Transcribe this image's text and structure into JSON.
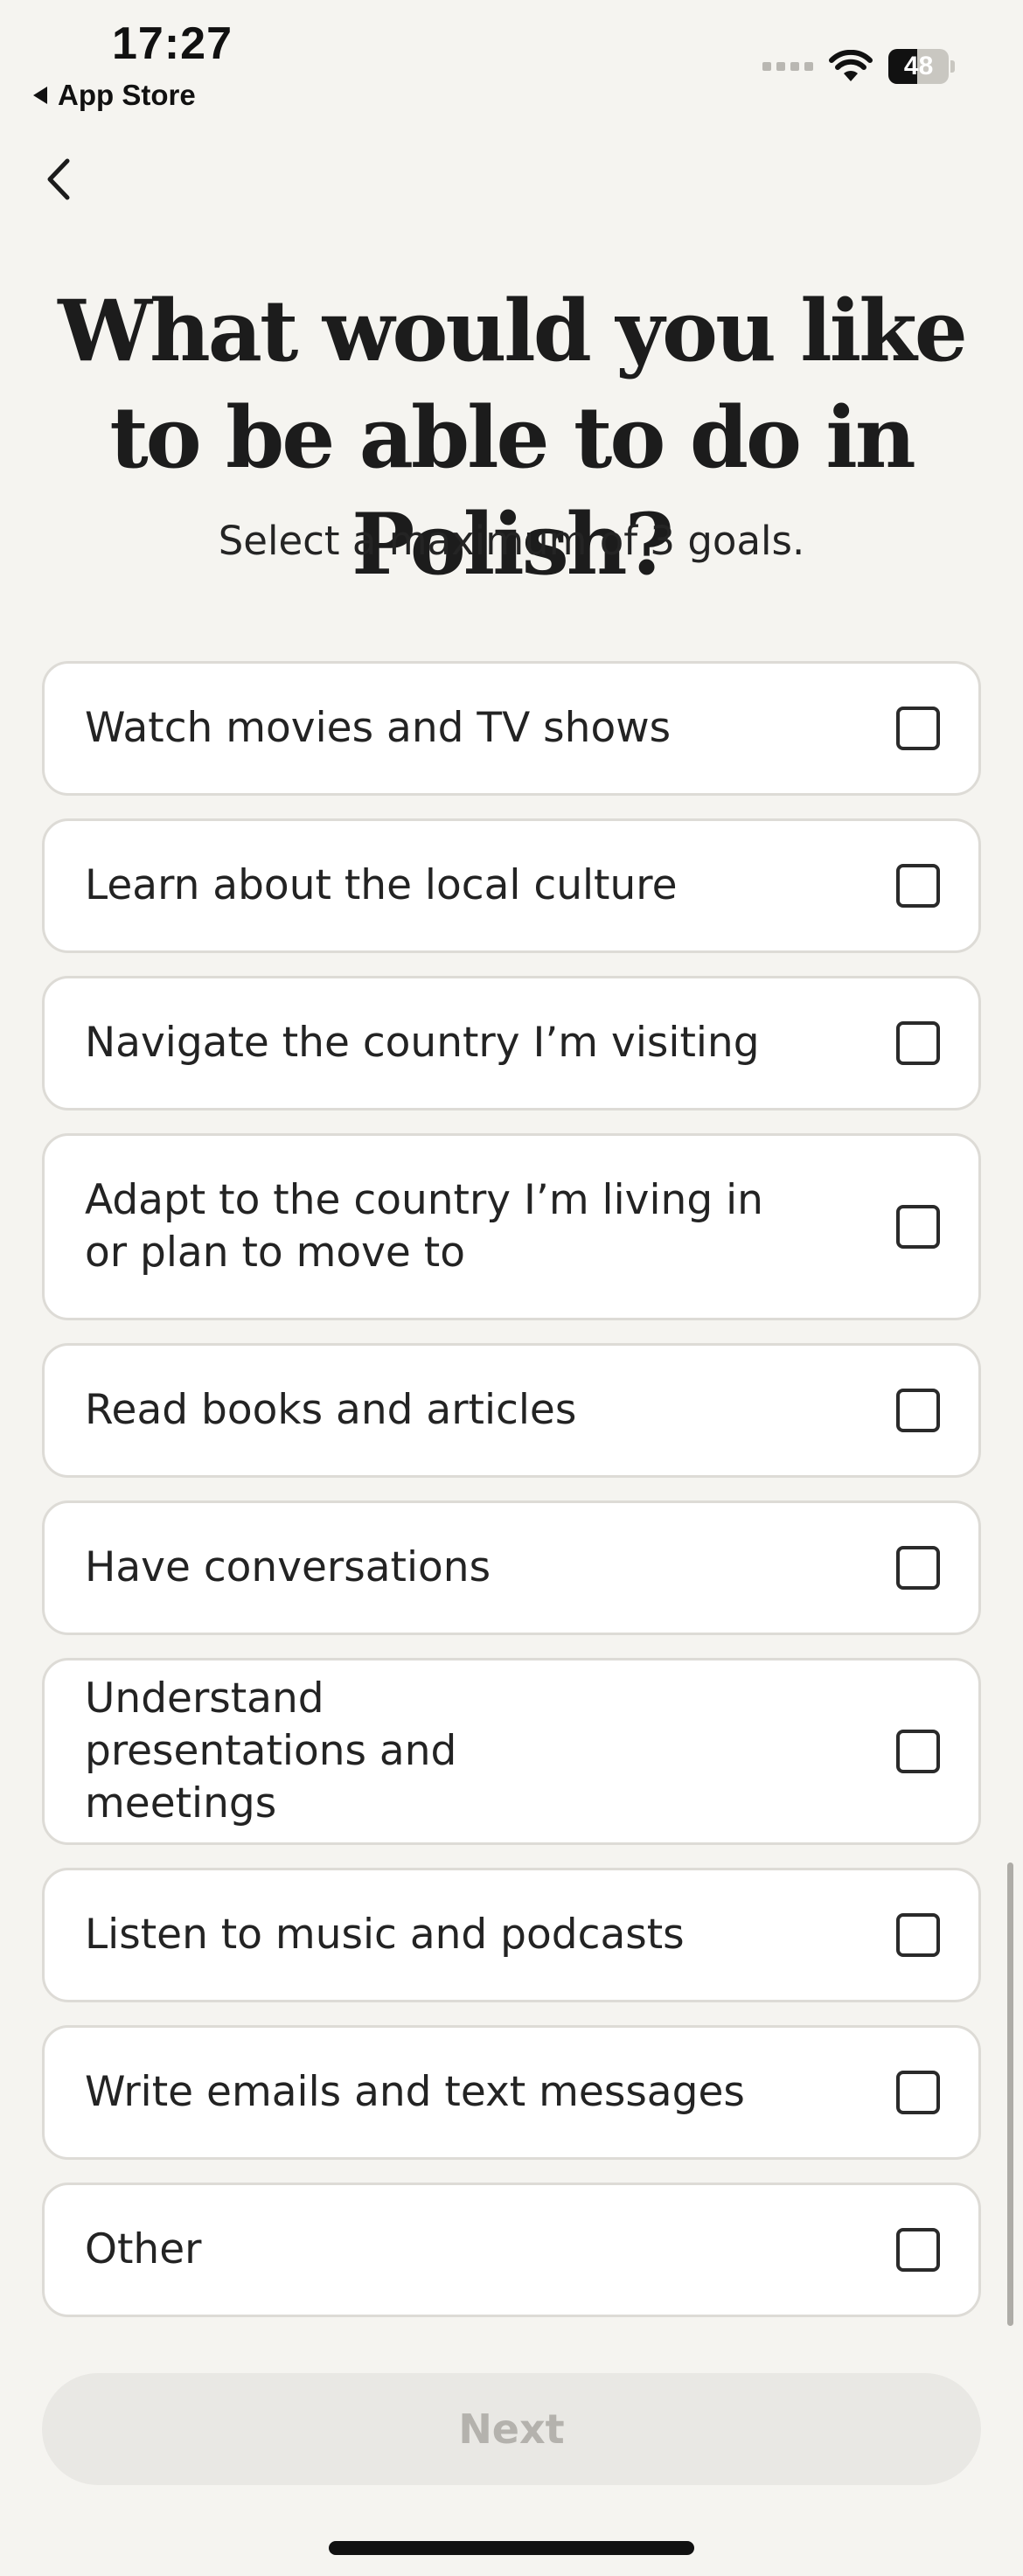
{
  "status_bar": {
    "time": "17:27",
    "back_app": "App Store",
    "battery": "48",
    "battery_level": 0.48
  },
  "header": {
    "title": "What would you like to be able to do in Polish?",
    "subtitle": "Select a maximum of 3 goals."
  },
  "goals": [
    {
      "label": "Watch movies and TV shows",
      "checked": false
    },
    {
      "label": "Learn about the local culture",
      "checked": false
    },
    {
      "label": "Navigate the country I’m visiting",
      "checked": false
    },
    {
      "label": "Adapt to the country I’m living in or plan to move to",
      "checked": false
    },
    {
      "label": "Read books and articles",
      "checked": false
    },
    {
      "label": "Have conversations",
      "checked": false
    },
    {
      "label": "Understand presentations and meetings",
      "checked": false
    },
    {
      "label": "Listen to music and podcasts",
      "checked": false
    },
    {
      "label": "Write emails and text messages",
      "checked": false
    },
    {
      "label": "Other",
      "checked": false
    }
  ],
  "footer": {
    "next_label": "Next",
    "next_enabled": false
  },
  "icons": {
    "back": "chevron-left-icon",
    "app_store_back": "triangle-left-icon",
    "signal": "signal-dots-icon",
    "wifi": "wifi-icon",
    "battery": "battery-icon"
  },
  "colors": {
    "background": "#f5f4f0",
    "card": "#ffffff",
    "card_border": "#dddbd6",
    "text": "#1f1f1f",
    "button_disabled_bg": "#e9e8e4",
    "button_disabled_text": "#b4b2ad"
  }
}
